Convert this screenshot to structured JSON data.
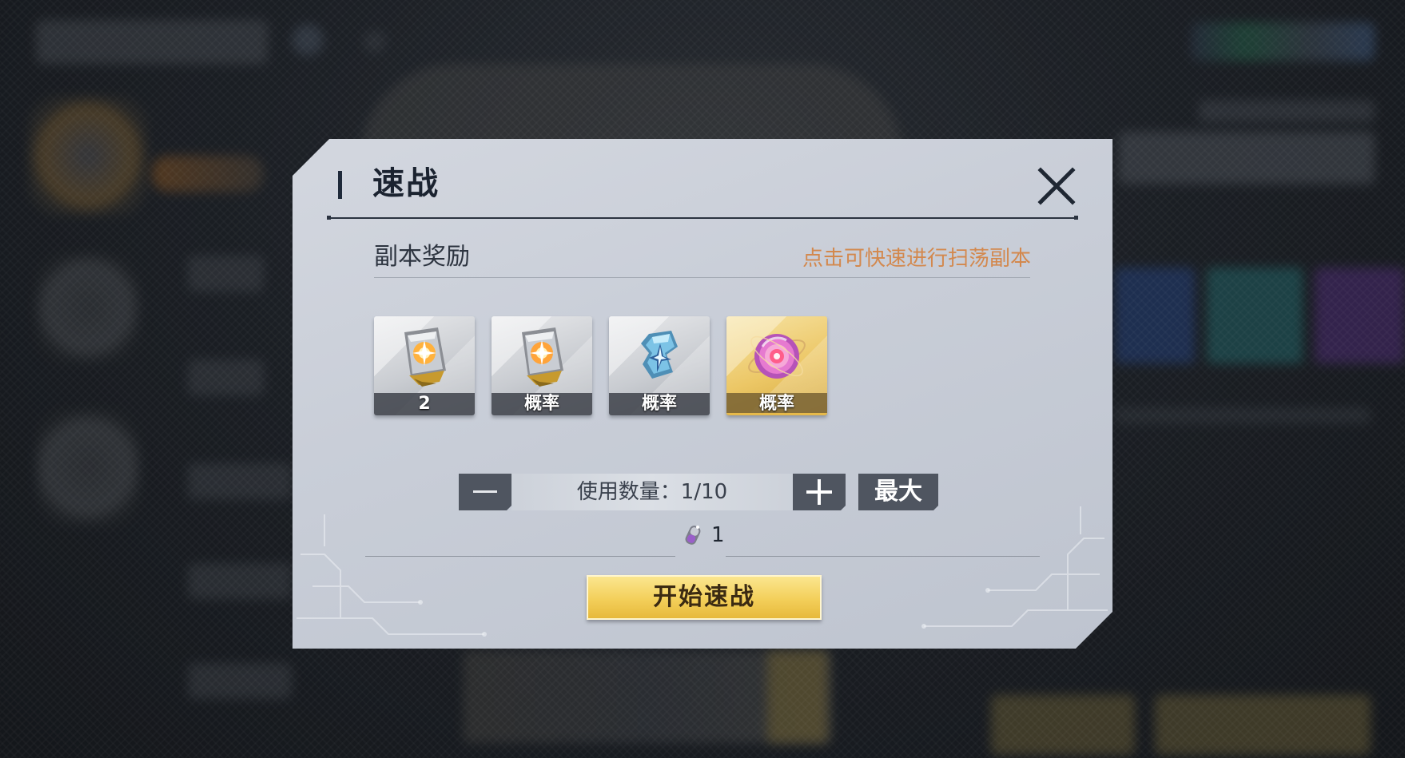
{
  "dialog": {
    "title": "速战",
    "close_icon": "close-x-icon",
    "rewards_label": "副本奖励",
    "rewards_hint": "点击可快速进行扫荡副本",
    "rewards": [
      {
        "icon": "orange-core-cube-icon",
        "caption": "2",
        "rarity": "grey"
      },
      {
        "icon": "orange-core-cube-icon",
        "caption": "概率",
        "rarity": "grey"
      },
      {
        "icon": "blue-crystal-cube-icon",
        "caption": "概率",
        "rarity": "grey"
      },
      {
        "icon": "pink-orb-icon",
        "caption": "概率",
        "rarity": "gold"
      }
    ],
    "quantity": {
      "label": "使用数量：1/10",
      "minus_icon": "minus-icon",
      "plus_icon": "plus-icon",
      "max_label": "最大"
    },
    "cost": {
      "icon": "stamina-capsule-icon",
      "value": "1"
    },
    "start_label": "开始速战"
  },
  "colors": {
    "hint": "#d3884d",
    "start_button": "#f3cf5a",
    "gold_rarity": "#ecc766",
    "control_button": "#4f5560"
  }
}
